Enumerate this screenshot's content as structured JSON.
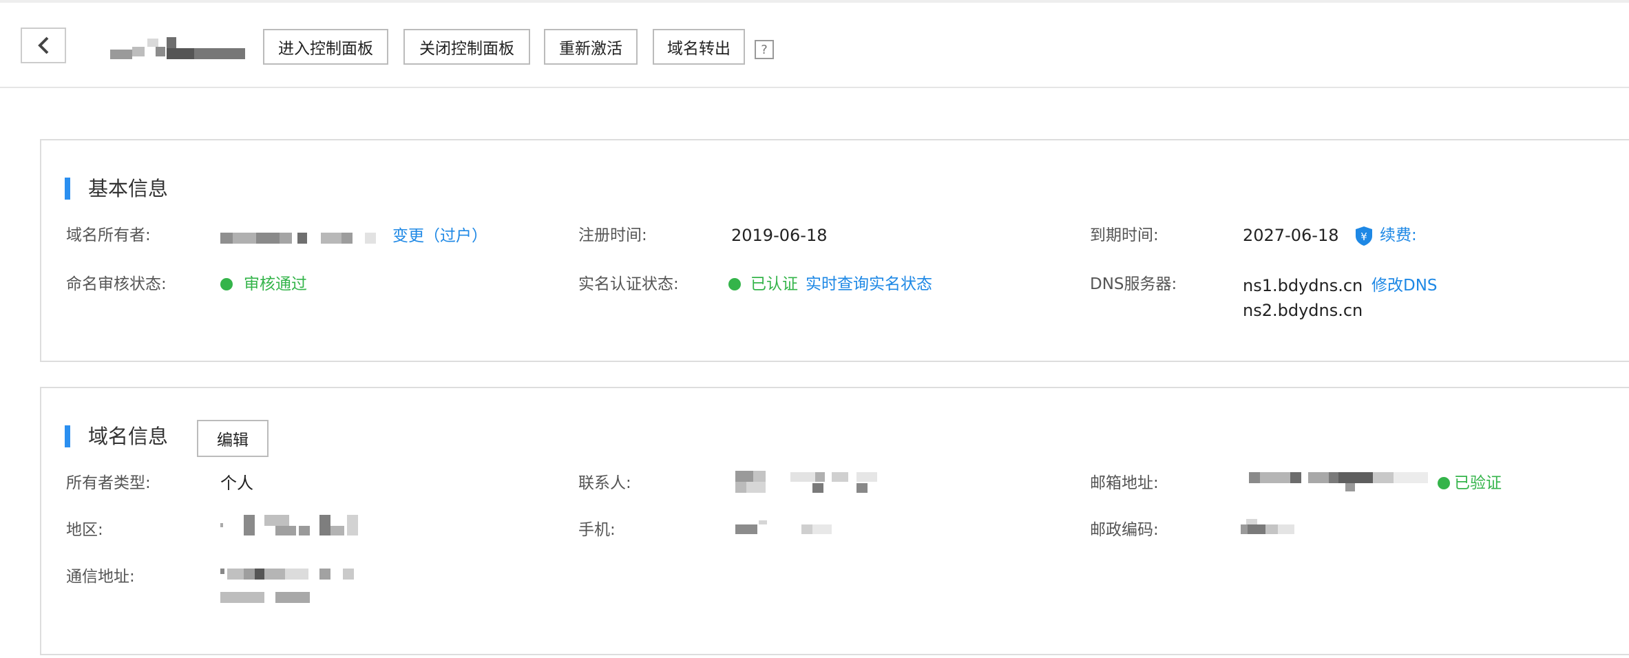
{
  "header": {
    "buttons": {
      "enter_panel": "进入控制面板",
      "close_panel": "关闭控制面板",
      "reactivate": "重新激活",
      "transfer_out": "域名转出"
    },
    "help_label": "?"
  },
  "basic_info": {
    "title": "基本信息",
    "owner_label": "域名所有者:",
    "owner_action": "变更（过户）",
    "reg_time_label": "注册时间:",
    "reg_time_value": "2019-06-18",
    "expire_label": "到期时间:",
    "expire_value": "2027-06-18",
    "renew_label": "续费:",
    "naming_status_label": "命名审核状态:",
    "naming_status_value": "审核通过",
    "realname_label": "实名认证状态:",
    "realname_value": "已认证",
    "realname_query": "实时查询实名状态",
    "dns_label": "DNS服务器:",
    "dns1": "ns1.bdydns.cn",
    "dns2": "ns2.bdydns.cn",
    "dns_modify": "修改DNS"
  },
  "domain_info": {
    "title": "域名信息",
    "edit_label": "编辑",
    "owner_type_label": "所有者类型:",
    "owner_type_value": "个人",
    "contact_label": "联系人:",
    "email_label": "邮箱地址:",
    "email_status": "已验证",
    "region_label": "地区:",
    "phone_label": "手机:",
    "postal_label": "邮政编码:",
    "address_label": "通信地址:"
  },
  "colors": {
    "accent_blue": "#2b8ff0",
    "link_blue": "#1e88e5",
    "success_green": "#34b44a"
  }
}
